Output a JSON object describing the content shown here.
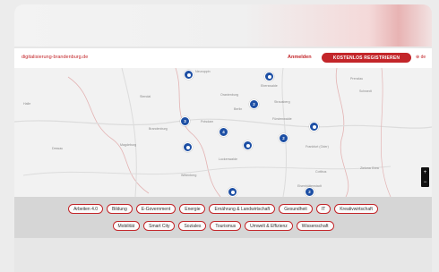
{
  "header": {
    "site": "digitalisierung-brandenburg.de",
    "login_label": "Anmelden",
    "register_label": "KOSTENLOS REGISTRIEREN",
    "language": "de"
  },
  "map": {
    "places": [
      "Berlin",
      "Magdeburg",
      "Potsdam",
      "Cottbus",
      "Frankfurt (Oder)",
      "Eberswalde",
      "Oranienburg",
      "Strausberg",
      "Fürstenwalde",
      "Luckenwalde",
      "Halle",
      "Dessau",
      "Stendal",
      "Neuruppin",
      "Prenzlau",
      "Schwedt",
      "Zielona Góra",
      "Wittenberg",
      "Brandenburg",
      "Eisenhüttenstadt"
    ],
    "cluster_counts": [
      "3",
      "4",
      "2",
      "2",
      "2"
    ],
    "zoom_in": "+",
    "zoom_out": "−"
  },
  "categories": {
    "row1": [
      "Arbeiten 4.0",
      "Bildung",
      "E-Government",
      "Energie",
      "Ernährung & Landwirtschaft",
      "Gesundheit",
      "IT",
      "Kreativwirtschaft"
    ],
    "row2": [
      "Mobilität",
      "Smart City",
      "Soziales",
      "Tourismus",
      "Umwelt & Effizienz",
      "Wissenschaft"
    ]
  },
  "colors": {
    "accent": "#c3262a",
    "pin": "#1d4fa4"
  }
}
